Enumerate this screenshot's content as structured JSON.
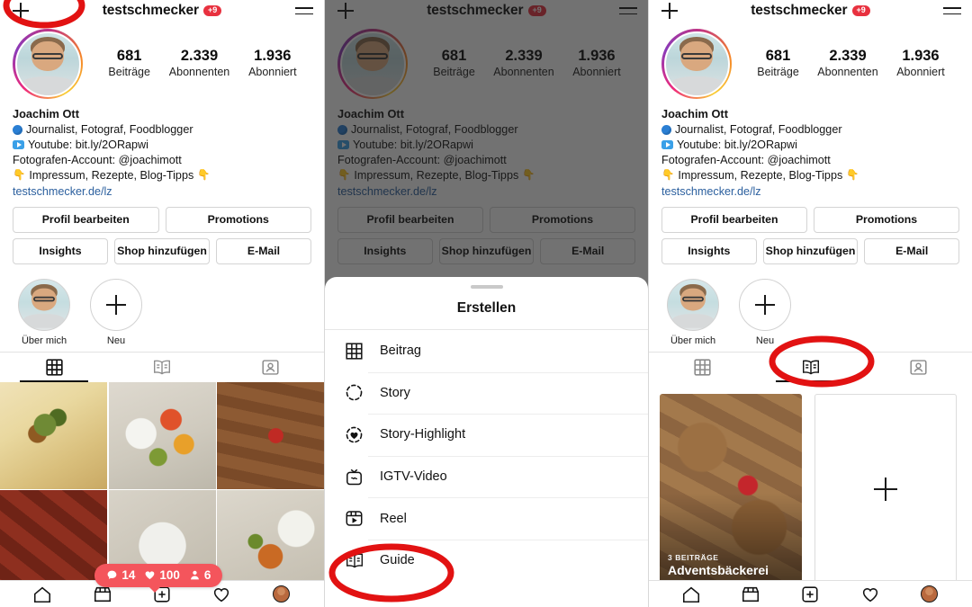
{
  "header": {
    "username": "testschmecker",
    "badge": "+9",
    "plus_icon": "plus-icon",
    "menu_icon": "hamburger-menu-icon"
  },
  "stats": [
    {
      "num": "681",
      "label": "Beiträge"
    },
    {
      "num": "2.339",
      "label": "Abonnenten"
    },
    {
      "num": "1.936",
      "label": "Abonniert"
    }
  ],
  "bio": {
    "name": "Joachim Ott",
    "line_globe": "Journalist, Fotograf, Foodblogger",
    "line_youtube": "Youtube: bit.ly/2ORapwi",
    "line_account": "Fotografen-Account: @joachimott",
    "line_links": "Impressum, Rezepte, Blog-Tipps",
    "emoji_down": "👇",
    "website": "testschmecker.de/lz"
  },
  "actions": {
    "edit_profile": "Profil bearbeiten",
    "promotions": "Promotions",
    "insights": "Insights",
    "add_shop": "Shop hinzufügen",
    "email": "E-Mail"
  },
  "highlights": [
    {
      "label": "Über mich",
      "kind": "photo"
    },
    {
      "label": "Neu",
      "kind": "plus"
    }
  ],
  "tabs": [
    {
      "name": "grid",
      "label": "Raster",
      "active_left": true
    },
    {
      "name": "guides",
      "label": "Guides",
      "active_right": true
    },
    {
      "name": "tagged",
      "label": "Markiert",
      "active_left": false
    }
  ],
  "engagement_badge": {
    "comments": "14",
    "likes": "100",
    "reach": "6",
    "color": "#f4555c"
  },
  "create_sheet": {
    "title": "Erstellen",
    "items": [
      {
        "icon": "grid-icon",
        "label": "Beitrag"
      },
      {
        "icon": "story-ring-icon",
        "label": "Story"
      },
      {
        "icon": "heart-ring-icon",
        "label": "Story-Highlight"
      },
      {
        "icon": "igtv-icon",
        "label": "IGTV-Video"
      },
      {
        "icon": "reel-clapper-icon",
        "label": "Reel"
      },
      {
        "icon": "guide-book-icon",
        "label": "Guide"
      }
    ],
    "highlighted_item": "Guide"
  },
  "guides": {
    "card": {
      "count": "3 BEITRÄGE",
      "title": "Adventsbäckerei"
    },
    "add_label": "+"
  },
  "bottom_nav": [
    {
      "name": "home-icon"
    },
    {
      "name": "shop-icon"
    },
    {
      "name": "add-post-icon"
    },
    {
      "name": "heart-icon"
    },
    {
      "name": "profile-avatar-icon"
    }
  ],
  "annotations": {
    "color": "#e21212",
    "targets": [
      "plus-button-top-left",
      "guide-menu-item",
      "guides-tab"
    ]
  }
}
